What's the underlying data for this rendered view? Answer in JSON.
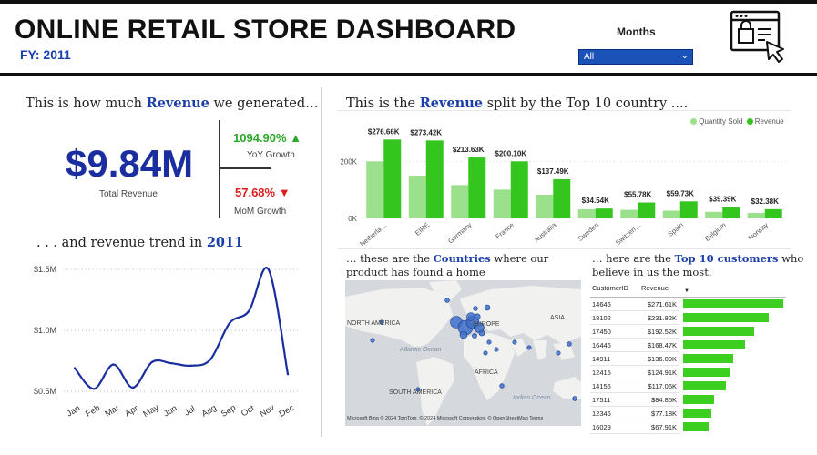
{
  "header": {
    "title": "ONLINE RETAIL STORE DASHBOARD",
    "fy_label": "FY: 2011",
    "months_label": "Months",
    "months_value": "All",
    "icon": "shopping-browser-cursor-icon"
  },
  "kpi": {
    "section_title_pre": "This is how much ",
    "section_title_bold": "Revenue",
    "section_title_post": " we generated…",
    "total_revenue": "$9.84M",
    "total_revenue_label": "Total Revenue",
    "yoy_value": "1094.90%",
    "yoy_arrow": "▲",
    "yoy_label": "YoY Growth",
    "mom_value": "57.68%",
    "mom_arrow": "▼",
    "mom_label": "MoM Growth",
    "colors": {
      "total": "#1a2ea0",
      "up": "#2aa827",
      "down": "#e01b1b"
    }
  },
  "trend": {
    "title_pre": ". . . and revenue trend in ",
    "title_bold": "2011"
  },
  "country": {
    "title_pre": "This is the ",
    "title_bold": "Revenue",
    "title_post": " split by the Top 10 country ....",
    "legend_quantity": "Quantity Sold",
    "legend_revenue": "Revenue"
  },
  "map": {
    "title_pre": "… these are the ",
    "title_bold": "Countries",
    "title_post": " where our",
    "title_line2": "product has found a home",
    "labels": [
      "NORTH AMERICA",
      "EUROPE",
      "ASIA",
      "Atlantic Ocean",
      "AFRICA",
      "SOUTH AMERICA",
      "Indian Ocean"
    ],
    "attribution": "© 2024 TomTom, © 2024 Microsoft Corporation, © OpenStreetMap Terms",
    "logo_text": "Microsoft Bing"
  },
  "customers": {
    "title_pre": "… here are the ",
    "title_bold": "Top 10 customers",
    "title_post": " who",
    "title_line2": "believe in us the most.",
    "col_id": "CustomerID",
    "col_revenue": "Revenue",
    "rows": [
      {
        "id": "14646",
        "revenue": "$271.61K",
        "value": 271.61
      },
      {
        "id": "18102",
        "revenue": "$231.82K",
        "value": 231.82
      },
      {
        "id": "17450",
        "revenue": "$192.52K",
        "value": 192.52
      },
      {
        "id": "16446",
        "revenue": "$168.47K",
        "value": 168.47
      },
      {
        "id": "14911",
        "revenue": "$136.09K",
        "value": 136.09
      },
      {
        "id": "12415",
        "revenue": "$124.91K",
        "value": 124.91
      },
      {
        "id": "14156",
        "revenue": "$117.06K",
        "value": 117.06
      },
      {
        "id": "17511",
        "revenue": "$84.85K",
        "value": 84.85
      },
      {
        "id": "12346",
        "revenue": "$77.18K",
        "value": 77.18
      },
      {
        "id": "16029",
        "revenue": "$67.91K",
        "value": 67.91
      }
    ]
  },
  "chart_data": [
    {
      "type": "line",
      "categories": [
        "Jan",
        "Feb",
        "Mar",
        "Apr",
        "May",
        "Jun",
        "Jul",
        "Aug",
        "Sep",
        "Oct",
        "Nov",
        "Dec"
      ],
      "series": [
        {
          "values": [
            0.69,
            0.52,
            0.72,
            0.53,
            0.74,
            0.73,
            0.71,
            0.76,
            1.06,
            1.16,
            1.5,
            0.64
          ]
        }
      ],
      "yticks": [
        "$0.5M",
        "$1.0M",
        "$1.5M"
      ],
      "ytick_values": [
        0.5,
        1.0,
        1.5
      ],
      "ylim": [
        0.5,
        1.5
      ],
      "grid": true,
      "color": "#1a2ea0"
    },
    {
      "type": "bar",
      "categories": [
        "Netherla…",
        "EIRE",
        "Germany",
        "France",
        "Australia",
        "Sweden",
        "Switzerl…",
        "Spain",
        "Belgium",
        "Norway"
      ],
      "series": [
        {
          "name": "Quantity Sold",
          "values": [
            200,
            150,
            117,
            101,
            83,
            32,
            30,
            27,
            23,
            19
          ],
          "color": "#9be08a"
        },
        {
          "name": "Revenue",
          "values": [
            276.66,
            273.42,
            213.63,
            200.1,
            137.49,
            34.54,
            55.78,
            59.73,
            39.39,
            32.38
          ],
          "color": "#35c51f"
        }
      ],
      "data_labels": [
        "$276.66K",
        "$273.42K",
        "$213.63K",
        "$200.10K",
        "$137.49K",
        "$34.54K",
        "$55.78K",
        "$59.73K",
        "$39.39K",
        "$32.38K"
      ],
      "yticks": [
        "0K",
        "200K"
      ],
      "ytick_values": [
        0,
        200
      ],
      "ylim": [
        0,
        300
      ],
      "legend": "top-right"
    },
    {
      "type": "bar",
      "categories": [
        "14646",
        "18102",
        "17450",
        "16446",
        "14911",
        "12415",
        "14156",
        "17511",
        "12346",
        "16029"
      ],
      "values": [
        271.61,
        231.82,
        192.52,
        168.47,
        136.09,
        124.91,
        117.06,
        84.85,
        77.18,
        67.91
      ]
    }
  ]
}
